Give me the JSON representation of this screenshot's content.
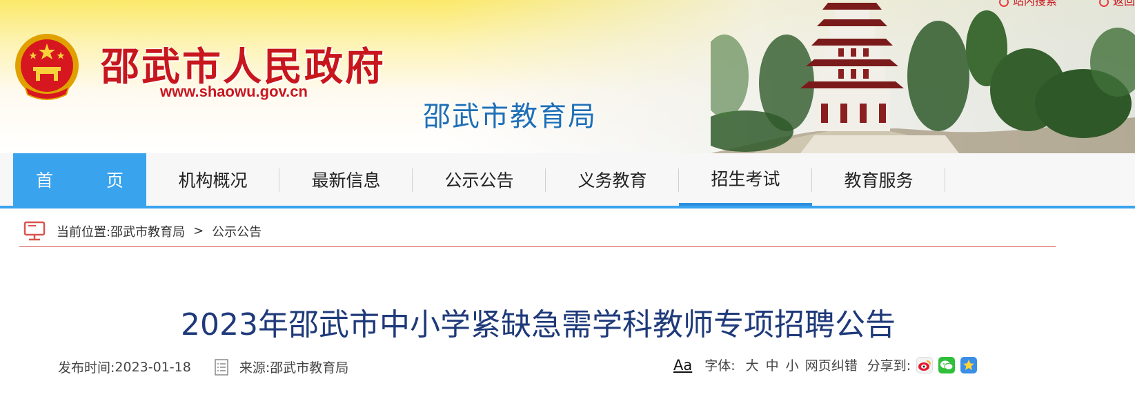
{
  "header": {
    "site_title": "邵武市人民政府",
    "site_url": "www.shaowu.gov.cn",
    "dept_title": "邵武市教育局",
    "top_links": [
      "站内搜索",
      "返回"
    ]
  },
  "nav": {
    "items": [
      {
        "label": "首　页"
      },
      {
        "label": "机构概况"
      },
      {
        "label": "最新信息"
      },
      {
        "label": "公示公告"
      },
      {
        "label": "义务教育"
      },
      {
        "label": "招生考试"
      },
      {
        "label": "教育服务"
      }
    ]
  },
  "breadcrumb": {
    "prefix": "当前位置:",
    "items": [
      "邵武市教育局",
      "公示公告"
    ],
    "separator": ">"
  },
  "article": {
    "title": "2023年邵武市中小学紧缺急需学科教师专项招聘公告",
    "publish_label": "发布时间:",
    "publish_date": "2023-01-18",
    "source_label": "来源:",
    "source": "邵武市教育局"
  },
  "tools": {
    "aa": "Aa",
    "font_label": "字体:",
    "font_sizes": [
      "大",
      "中",
      "小"
    ],
    "correction": "网页纠错",
    "share_label": "分享到:",
    "share_targets": [
      "weibo-icon",
      "wechat-icon",
      "qzone-icon"
    ]
  },
  "colors": {
    "accent": "#3aa3ee",
    "title_red": "#c8161d",
    "dept_blue": "#1f6fb6",
    "article_title": "#1f3a7a",
    "breadcrumb_line": "#d9534f"
  }
}
